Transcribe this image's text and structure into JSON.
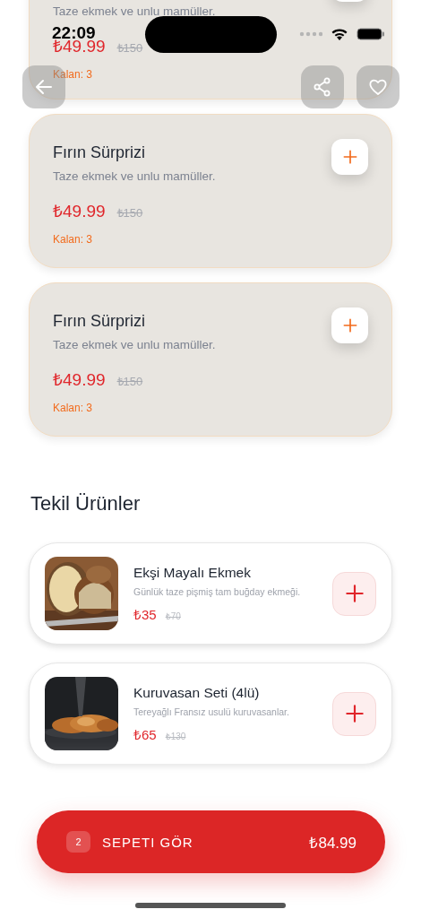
{
  "status_bar": {
    "time": "22:09"
  },
  "deals": [
    {
      "description": "Taze ekmek ve unlu mamüller.",
      "price": "₺49.99",
      "old_price": "₺150",
      "stock": "Kalan: 3"
    },
    {
      "title": "Fırın Sürprizi",
      "description": "Taze ekmek ve unlu mamüller.",
      "price": "₺49.99",
      "old_price": "₺150",
      "stock": "Kalan: 3"
    },
    {
      "title": "Fırın Sürprizi",
      "description": "Taze ekmek ve unlu mamüller.",
      "price": "₺49.99",
      "old_price": "₺150",
      "stock": "Kalan: 3"
    }
  ],
  "section_title": "Tekil Ürünler",
  "products": [
    {
      "name": "Ekşi Mayalı Ekmek",
      "description": "Günlük taze pişmiş tam buğday ekmeği.",
      "price": "₺35",
      "old_price": "₺70"
    },
    {
      "name": "Kuruvasan Seti (4lü)",
      "description": "Tereyağlı Fransız usulü kuruvasanlar.",
      "price": "₺65",
      "old_price": "₺130"
    }
  ],
  "cart": {
    "count": "2",
    "label": "SEPETI GÖR",
    "total": "₺84.99"
  }
}
